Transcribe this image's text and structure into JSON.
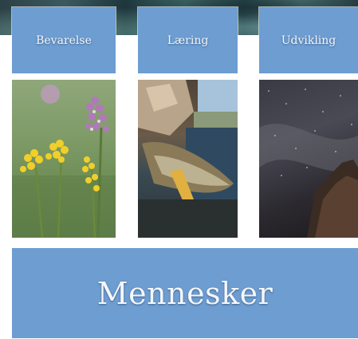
{
  "tiles": {
    "bevarelse": "Bevarelse",
    "laering": "Læring",
    "udvikling": "Udvikling",
    "mennesker": "Mennesker"
  },
  "photos": {
    "left": "flowers-image",
    "middle": "fish-image",
    "right": "night-sky-image"
  },
  "colors": {
    "tile_blue": "#6d9dd1",
    "tile_text": "#f4f7fb"
  }
}
